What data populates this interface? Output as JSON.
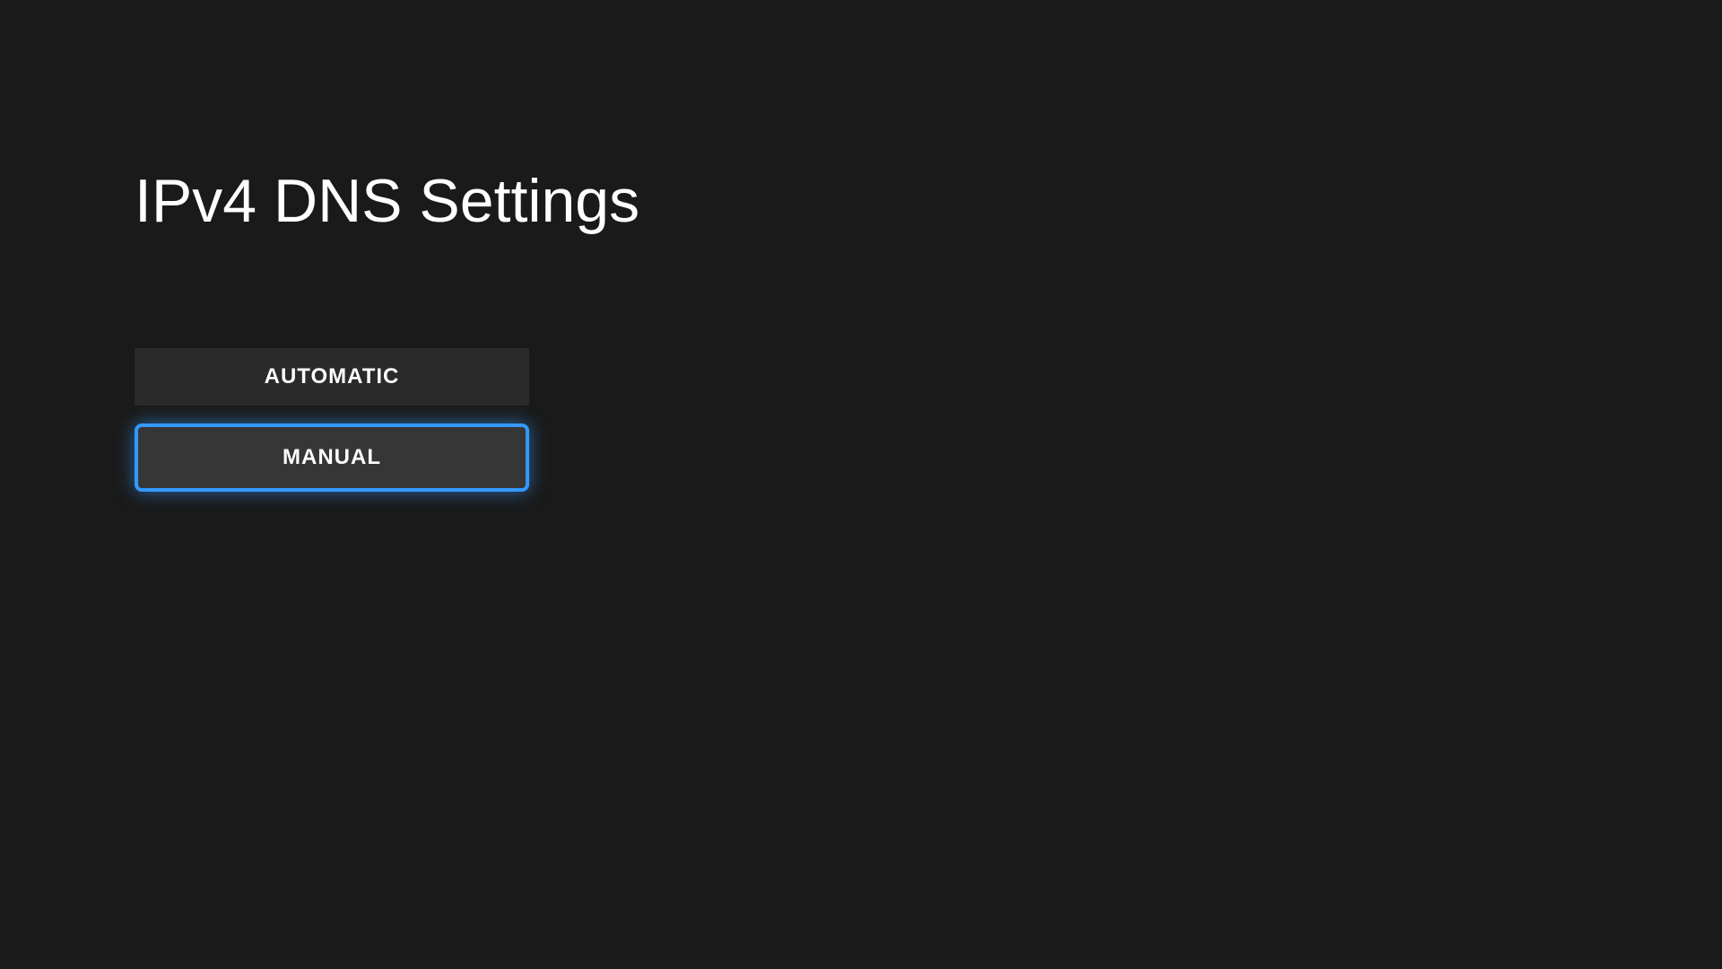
{
  "title": "IPv4 DNS Settings",
  "options": [
    {
      "label": "AUTOMATIC",
      "focused": false
    },
    {
      "label": "MANUAL",
      "focused": true
    }
  ]
}
